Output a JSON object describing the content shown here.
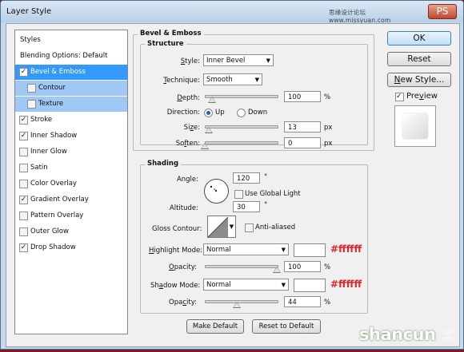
{
  "window": {
    "title": "Layer Style"
  },
  "watermark": {
    "text": "思缘设计论坛 www.missyuan.com",
    "badge": "PS"
  },
  "styles_list": {
    "header": "Styles",
    "blending": "Blending Options: Default",
    "items": [
      {
        "label": "Bevel & Emboss",
        "checked": true,
        "selected": true
      },
      {
        "label": "Contour",
        "checked": false,
        "sub": true
      },
      {
        "label": "Texture",
        "checked": false,
        "sub": true
      },
      {
        "label": "Stroke",
        "checked": true
      },
      {
        "label": "Inner Shadow",
        "checked": true
      },
      {
        "label": "Inner Glow",
        "checked": false
      },
      {
        "label": "Satin",
        "checked": false
      },
      {
        "label": "Color Overlay",
        "checked": false
      },
      {
        "label": "Gradient Overlay",
        "checked": true
      },
      {
        "label": "Pattern Overlay",
        "checked": false
      },
      {
        "label": "Outer Glow",
        "checked": false
      },
      {
        "label": "Drop Shadow",
        "checked": true
      }
    ]
  },
  "bevel": {
    "title": "Bevel & Emboss",
    "structure_title": "Structure",
    "style_label": "Style:",
    "style_value": "Inner Bevel",
    "technique_label": "Technique:",
    "technique_value": "Smooth",
    "depth_label": "Depth:",
    "depth_value": "100",
    "depth_unit": "%",
    "depth_level": 0.1,
    "direction_label": "Direction:",
    "dir_up": "Up",
    "dir_down": "Down",
    "size_label": "Size:",
    "size_value": "13",
    "size_unit": "px",
    "size_level": 0.05,
    "soften_label": "Soften:",
    "soften_value": "0",
    "soften_unit": "px",
    "soften_level": 0.0
  },
  "shading": {
    "title": "Shading",
    "angle_label": "Angle:",
    "angle_value": "120",
    "angle_unit": "°",
    "global_light_label": "Use Global Light",
    "altitude_label": "Altitude:",
    "altitude_value": "30",
    "altitude_unit": "°",
    "gloss_label": "Gloss Contour:",
    "anti_aliased_label": "Anti-aliased",
    "highlight_mode_label": "Highlight Mode:",
    "highlight_mode_value": "Normal",
    "highlight_color": "#ffffff",
    "highlight_hex": "#ffffff",
    "highlight_opacity_label": "Opacity:",
    "highlight_opacity_value": "100",
    "highlight_opacity_unit": "%",
    "highlight_opacity_level": 1.0,
    "shadow_mode_label": "Shadow Mode:",
    "shadow_mode_value": "Normal",
    "shadow_color": "#ffffff",
    "shadow_hex": "#ffffff",
    "shadow_opacity_label": "Opacity:",
    "shadow_opacity_value": "44",
    "shadow_opacity_unit": "%",
    "shadow_opacity_level": 0.44
  },
  "buttons": {
    "make_default": "Make Default",
    "reset_default": "Reset to Default",
    "ok": "OK",
    "reset": "Reset",
    "new_style": "New Style...",
    "preview": "Preview"
  },
  "branding": {
    "logo": "shancun",
    "sub1": "山村",
    "sub2": ".net"
  }
}
